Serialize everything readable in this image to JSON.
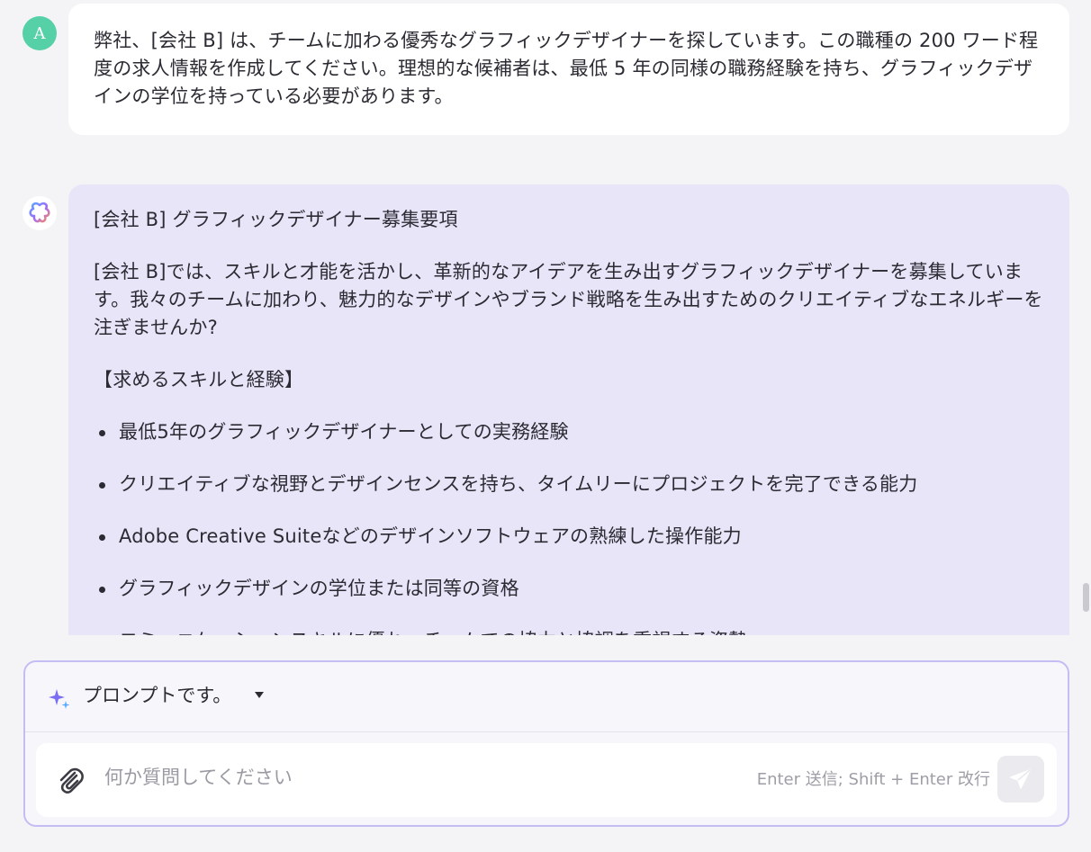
{
  "user_message": {
    "avatar_initial": "A",
    "text": "弊社、[会社 B] は、チームに加わる優秀なグラフィックデザイナーを探しています。この職種の 200 ワード程度の求人情報を作成してください。理想的な候補者は、最低 5 年の同様の職務経験を持ち、グラフィックデザインの学位を持っている必要があります。"
  },
  "assistant_message": {
    "title": "[会社 B] グラフィックデザイナー募集要項",
    "intro": "[会社 B]では、スキルと才能を活かし、革新的なアイデアを生み出すグラフィックデザイナーを募集しています。我々のチームに加わり、魅力的なデザインやブランド戦略を生み出すためのクリエイティブなエネルギーを注ぎませんか?",
    "section_heading": "【求めるスキルと経験】",
    "bullets": [
      "最低5年のグラフィックデザイナーとしての実務経験",
      "クリエイティブな視野とデザインセンスを持ち、タイムリーにプロジェクトを完了できる能力",
      "Adobe Creative Suiteなどのデザインソフトウェアの熟練した操作能力",
      "グラフィックデザインの学位または同等の資格",
      "コミュニケーションスキルに優れ、チームでの協力と協調を重視する姿勢"
    ]
  },
  "composer": {
    "prompt_selector_label": "プロンプトです。",
    "input_placeholder": "何か質問してください",
    "input_value": "",
    "shortcut_hint": "Enter 送信; Shift + Enter 改行"
  },
  "icons": {
    "sparkle": "sparkle-icon",
    "attach": "paperclip-icon",
    "send": "send-icon",
    "bot": "bot-logo-icon"
  },
  "colors": {
    "user_avatar": "#56d0a6",
    "assistant_bubble": "#e9e5f9",
    "composer_border": "#c3bdf3",
    "accent_purple": "#7b6cf6"
  }
}
